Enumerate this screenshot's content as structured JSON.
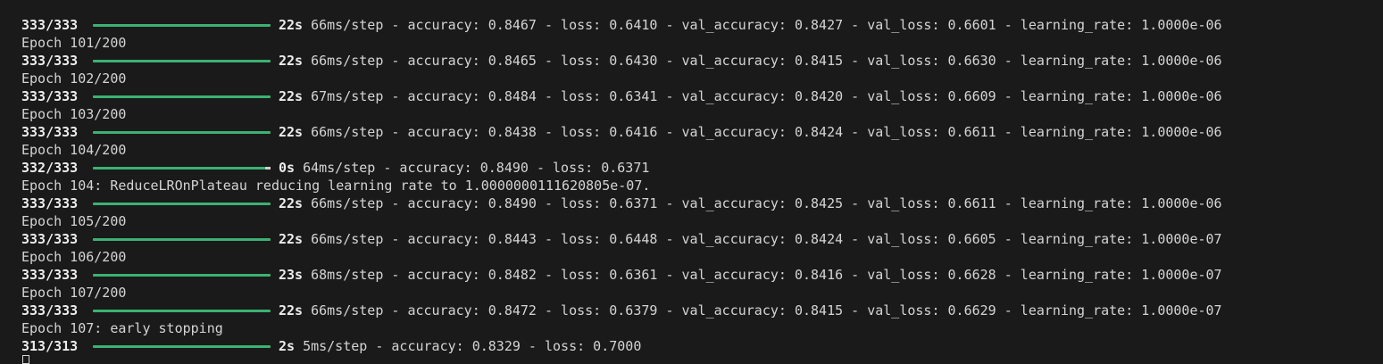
{
  "lines": [
    {
      "type": "progress",
      "steps": "333/333",
      "progress": 1.0,
      "time": "22s",
      "metrics": "66ms/step - accuracy: 0.8467 - loss: 0.6410 - val_accuracy: 0.8427 - val_loss: 0.6601 - learning_rate: 1.0000e-06"
    },
    {
      "type": "text",
      "text": "Epoch 101/200"
    },
    {
      "type": "progress",
      "steps": "333/333",
      "progress": 1.0,
      "time": "22s",
      "metrics": "66ms/step - accuracy: 0.8465 - loss: 0.6430 - val_accuracy: 0.8415 - val_loss: 0.6630 - learning_rate: 1.0000e-06"
    },
    {
      "type": "text",
      "text": "Epoch 102/200"
    },
    {
      "type": "progress",
      "steps": "333/333",
      "progress": 1.0,
      "time": "22s",
      "metrics": "67ms/step - accuracy: 0.8484 - loss: 0.6341 - val_accuracy: 0.8420 - val_loss: 0.6609 - learning_rate: 1.0000e-06"
    },
    {
      "type": "text",
      "text": "Epoch 103/200"
    },
    {
      "type": "progress",
      "steps": "333/333",
      "progress": 1.0,
      "time": "22s",
      "metrics": "66ms/step - accuracy: 0.8438 - loss: 0.6416 - val_accuracy: 0.8424 - val_loss: 0.6611 - learning_rate: 1.0000e-06"
    },
    {
      "type": "text",
      "text": "Epoch 104/200"
    },
    {
      "type": "progress",
      "steps": "332/333",
      "progress": 0.97,
      "time": "0s",
      "metrics": "64ms/step - accuracy: 0.8490 - loss: 0.6371"
    },
    {
      "type": "text",
      "text": "Epoch 104: ReduceLROnPlateau reducing learning rate to 1.0000000111620805e-07."
    },
    {
      "type": "progress",
      "steps": "333/333",
      "progress": 1.0,
      "time": "22s",
      "metrics": "66ms/step - accuracy: 0.8490 - loss: 0.6371 - val_accuracy: 0.8425 - val_loss: 0.6611 - learning_rate: 1.0000e-06"
    },
    {
      "type": "text",
      "text": "Epoch 105/200"
    },
    {
      "type": "progress",
      "steps": "333/333",
      "progress": 1.0,
      "time": "22s",
      "metrics": "66ms/step - accuracy: 0.8443 - loss: 0.6448 - val_accuracy: 0.8424 - val_loss: 0.6605 - learning_rate: 1.0000e-07"
    },
    {
      "type": "text",
      "text": "Epoch 106/200"
    },
    {
      "type": "progress",
      "steps": "333/333",
      "progress": 1.0,
      "time": "23s",
      "metrics": "68ms/step - accuracy: 0.8482 - loss: 0.6361 - val_accuracy: 0.8416 - val_loss: 0.6628 - learning_rate: 1.0000e-07"
    },
    {
      "type": "text",
      "text": "Epoch 107/200"
    },
    {
      "type": "progress",
      "steps": "333/333",
      "progress": 1.0,
      "time": "22s",
      "metrics": "66ms/step - accuracy: 0.8472 - loss: 0.6379 - val_accuracy: 0.8415 - val_loss: 0.6629 - learning_rate: 1.0000e-07"
    },
    {
      "type": "text",
      "text": "Epoch 107: early stopping"
    },
    {
      "type": "progress",
      "steps": "313/313",
      "progress": 1.0,
      "time": "2s",
      "metrics": "5ms/step - accuracy: 0.8329 - loss: 0.7000"
    }
  ],
  "colors": {
    "background": "#1a1a1a",
    "text": "#d4d4d4",
    "progress_fill": "#3bb273",
    "progress_track": "#3a3a3a"
  }
}
